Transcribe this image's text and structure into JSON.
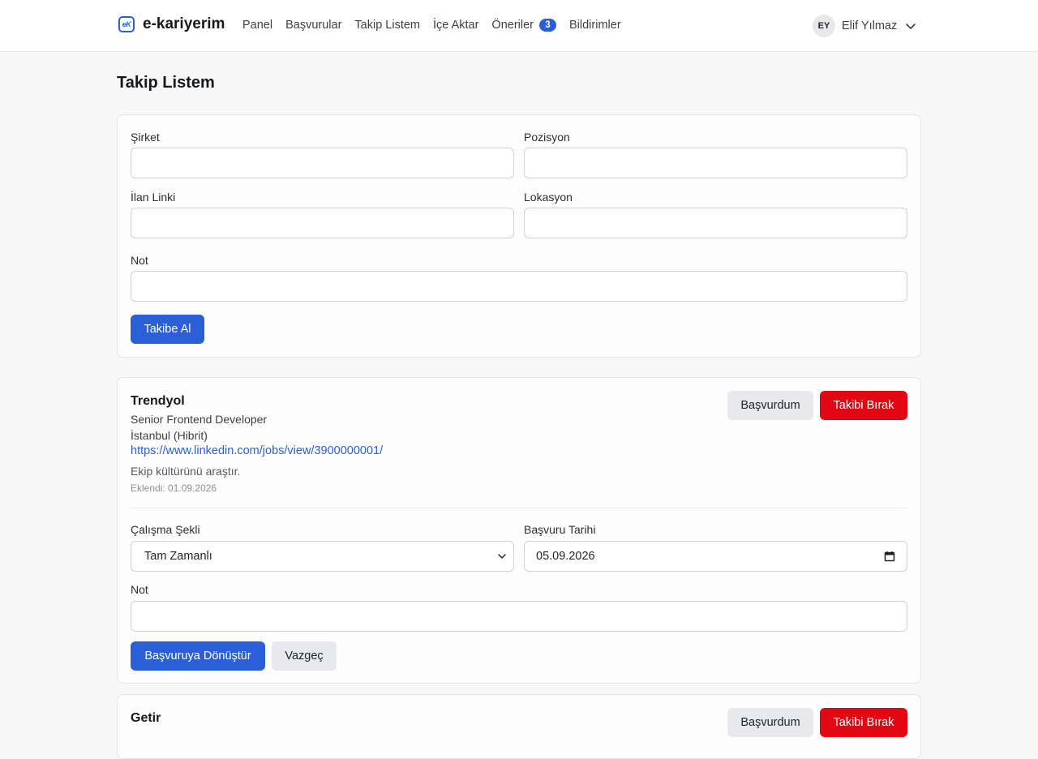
{
  "brand": {
    "logo_text": "eK",
    "name": "e-kariyerim"
  },
  "nav": {
    "links": [
      "Panel",
      "Başvurular",
      "Takip Listem",
      "İçe Aktar",
      "Öneriler",
      "Bildirimler"
    ],
    "badge_count": "3"
  },
  "user": {
    "initials": "EY",
    "name": "Elif Yılmaz"
  },
  "page": {
    "title": "Takip Listem"
  },
  "form": {
    "company_label": "Şirket",
    "position_label": "Pozisyon",
    "link_label": "İlan Linki",
    "location_label": "Lokasyon",
    "note_label": "Not",
    "company_value": "",
    "position_value": "",
    "link_value": "",
    "location_value": "",
    "note_value": "",
    "submit_label": "Takibe Al"
  },
  "items": [
    {
      "company": "Trendyol",
      "position": "Senior Frontend Developer",
      "location": "İstanbul (Hibrit)",
      "url": "https://www.linkedin.com/jobs/view/3900000001/",
      "note": "Ekip kültürünü araştır.",
      "added": "Eklendi: 01.09.2026",
      "applied_label": "Başvurdum",
      "unfollow_label": "Takibi Bırak",
      "work_type_label": "Çalışma Şekli",
      "work_type_value": "Tam Zamanlı",
      "apply_date_label": "Başvuru Tarihi",
      "apply_date_value": "05.09.2026",
      "convert_note_label": "Not",
      "convert_note_value": "",
      "convert_label": "Başvuruya Dönüştür",
      "cancel_label": "Vazgeç"
    },
    {
      "company": "Getir",
      "applied_label": "Başvurdum",
      "unfollow_label": "Takibi Bırak"
    }
  ]
}
